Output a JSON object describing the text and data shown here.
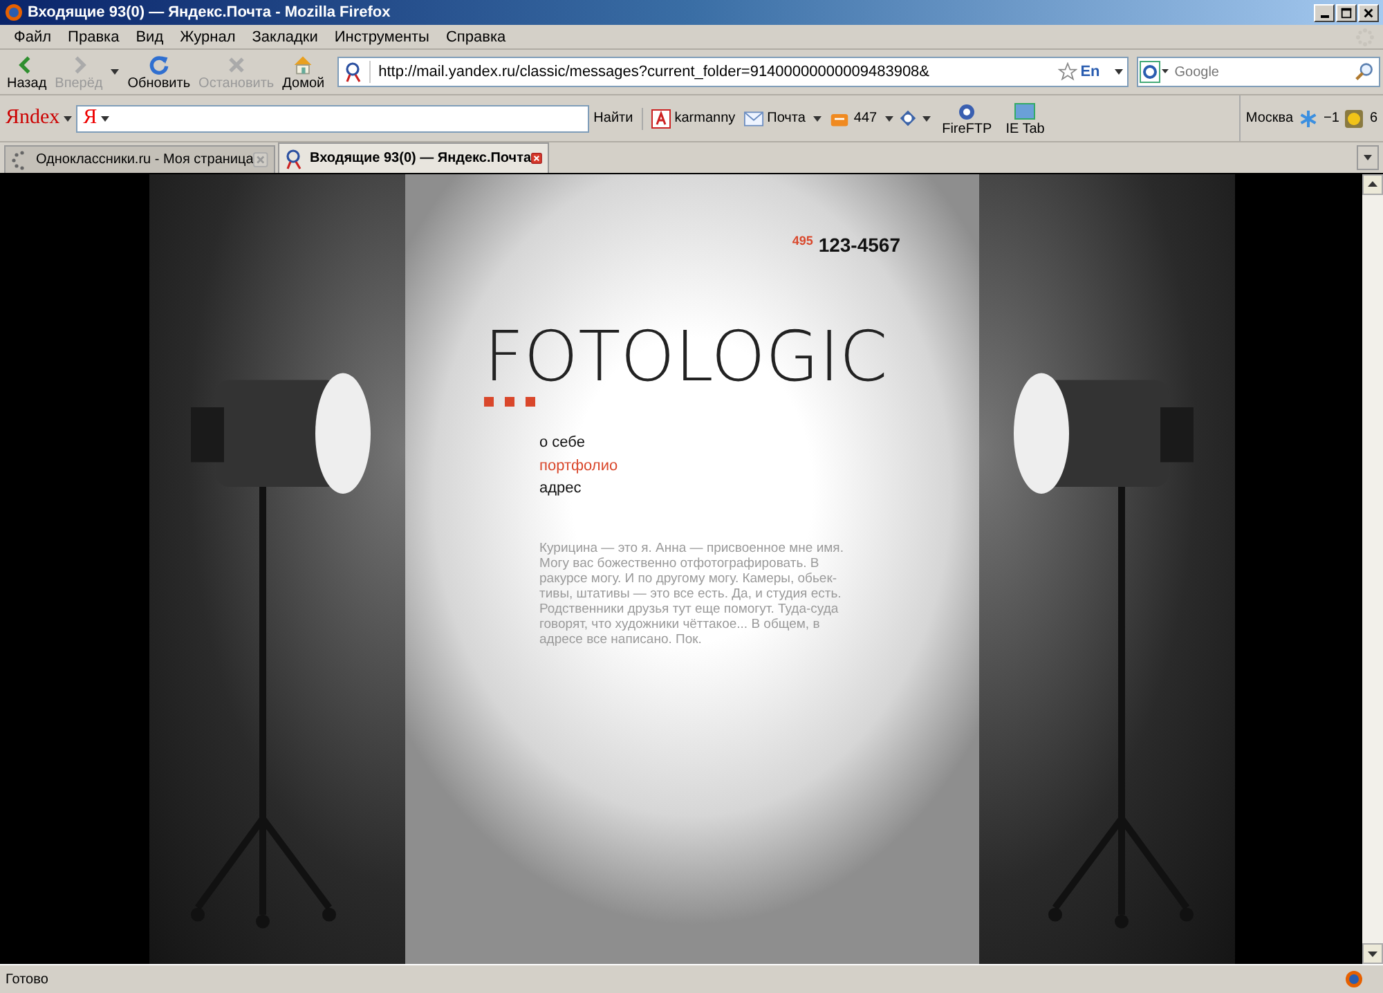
{
  "window": {
    "title": "Входящие 93(0) — Яндекс.Почта - Mozilla Firefox"
  },
  "menu": [
    "Файл",
    "Правка",
    "Вид",
    "Журнал",
    "Закладки",
    "Инструменты",
    "Справка"
  ],
  "nav_buttons": [
    {
      "kind": "back",
      "label": "Назад",
      "disabled": false
    },
    {
      "kind": "forward",
      "label": "Вперёд",
      "disabled": true
    },
    {
      "kind": "reload",
      "label": "Обновить",
      "disabled": false
    },
    {
      "kind": "stop",
      "label": "Остановить",
      "disabled": true
    },
    {
      "kind": "home",
      "label": "Домой",
      "disabled": false
    }
  ],
  "address": {
    "value": "http://mail.yandex.ru/classic/messages?current_folder=91400000000009483908&",
    "lang": "En"
  },
  "search": {
    "placeholder": "Google"
  },
  "yandex_bar": {
    "logo": "Яndex",
    "field_logo": "Я",
    "find": "Найти",
    "user": "karmanny",
    "mail": "Почта",
    "count": "447",
    "buttons": [
      "FireFTP",
      "IE Tab"
    ],
    "city": "Москва",
    "temperature": "−1",
    "badge": "6"
  },
  "tabs": [
    {
      "label": "Одноклассники.ru - Моя страница",
      "selected": false
    },
    {
      "label": "Входящие 93(0) — Яндекс.Почта",
      "selected": true
    }
  ],
  "page": {
    "phone_code": "495",
    "phone": "123-4567",
    "logo": "FOTOLOGIC",
    "nav": [
      {
        "label": "о себе",
        "selected": false
      },
      {
        "label": "портфолио",
        "selected": true
      },
      {
        "label": "адрес",
        "selected": false
      }
    ],
    "text": "Курицина — это я. Анна — присвоенное мне имя.\nМогу вас божественно отфотографировать. В\nракурсе могу. И по другому могу. Камеры, обьек-\nтивы, штативы — это все есть. Да, и студия есть.\nРодственники друзья тут еще помогут. Туда-суда\nговорят, что художники чёттакое... В общем, в\nадресе все написано. Пок."
  },
  "status_bar": {
    "text": "Готово"
  }
}
